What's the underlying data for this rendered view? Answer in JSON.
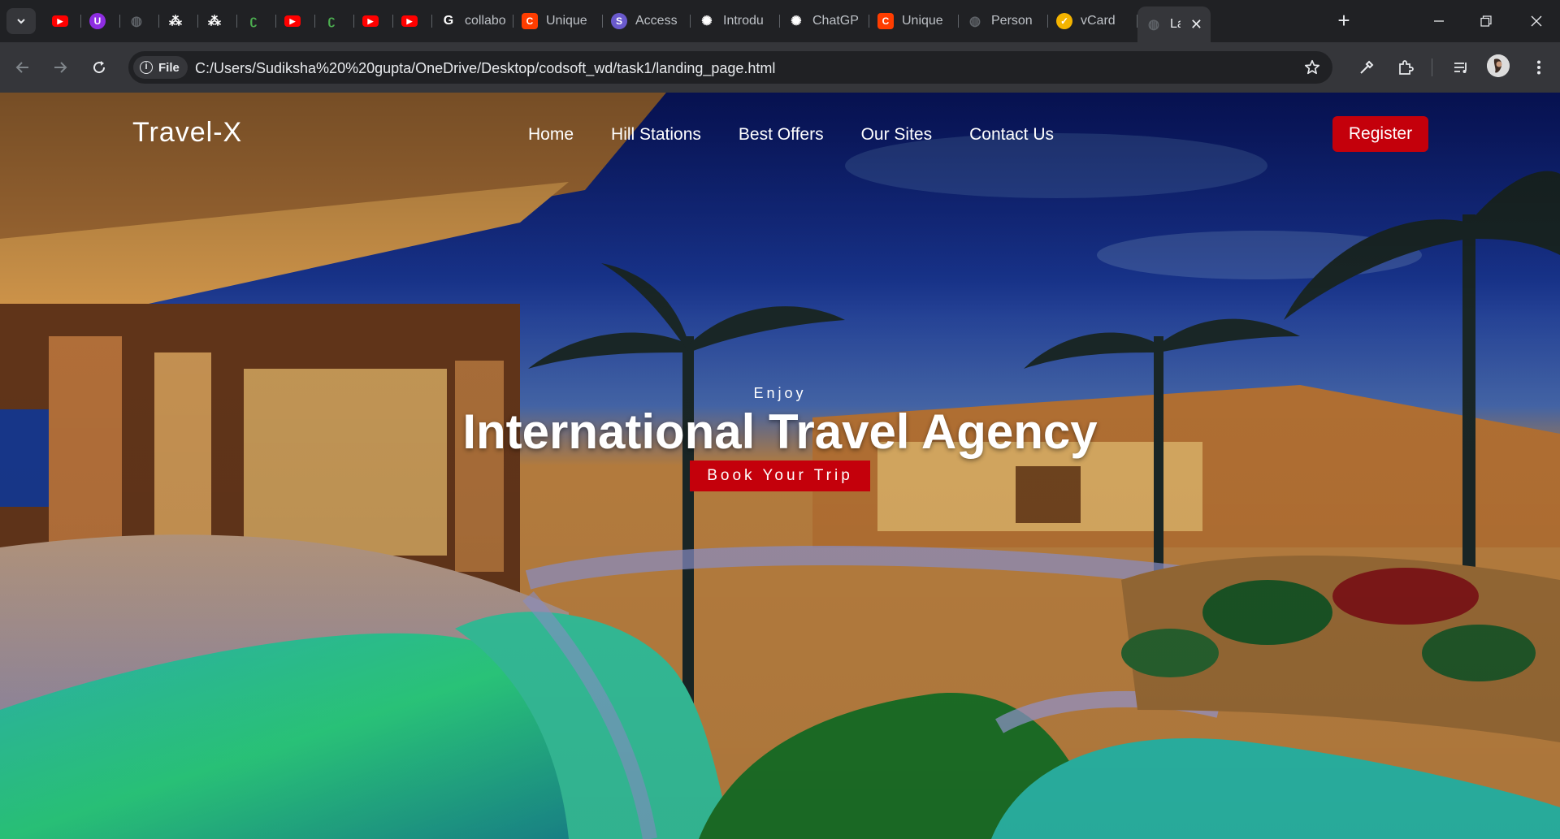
{
  "browser": {
    "tabs": [
      {
        "icon": "youtube-icon",
        "label": "",
        "color": "#ff0000"
      },
      {
        "icon": "u-icon",
        "label": "",
        "color": "#8e2de2"
      },
      {
        "icon": "globe-icon",
        "label": "",
        "color": "#5f6368"
      },
      {
        "icon": "dice-icon",
        "label": "",
        "color": "#ffffff"
      },
      {
        "icon": "dice-icon",
        "label": "",
        "color": "#ffffff"
      },
      {
        "icon": "leetcode-icon",
        "label": "",
        "color": "#4caf50"
      },
      {
        "icon": "youtube-icon",
        "label": "",
        "color": "#ff0000"
      },
      {
        "icon": "leetcode-icon",
        "label": "",
        "color": "#4caf50"
      },
      {
        "icon": "youtube-icon",
        "label": "",
        "color": "#ff0000"
      },
      {
        "icon": "youtube-icon",
        "label": "",
        "color": "#ff0000"
      },
      {
        "icon": "google-icon",
        "label": "collabo",
        "color": "#ffffff"
      },
      {
        "icon": "c-icon",
        "label": "Unique",
        "color": "#ff3d00"
      },
      {
        "icon": "s-icon",
        "label": "Access",
        "color": "#6a5acd"
      },
      {
        "icon": "openai-icon",
        "label": "Introdu",
        "color": "#ffffff"
      },
      {
        "icon": "openai-icon",
        "label": "ChatGP",
        "color": "#ffffff"
      },
      {
        "icon": "c-icon",
        "label": "Unique",
        "color": "#ff3d00"
      },
      {
        "icon": "globe-icon",
        "label": "Person",
        "color": "#5f6368"
      },
      {
        "icon": "vcard-icon",
        "label": "vCard",
        "color": "#f4b400"
      },
      {
        "icon": "globe-icon",
        "label": "La",
        "color": "#5f6368",
        "active": true
      }
    ],
    "new_tab_label": "+",
    "close_tab_glyph": "✕",
    "origin_chip": "File",
    "address": "C:/Users/Sudiksha%20%20gupta/OneDrive/Desktop/codsoft_wd/task1/landing_page.html"
  },
  "site": {
    "logo": "Travel-X",
    "nav": [
      "Home",
      "Hill Stations",
      "Best Offers",
      "Our Sites",
      "Contact Us"
    ],
    "register_label": "Register",
    "hero": {
      "eyebrow": "Enjoy",
      "title": "International Travel Agency",
      "cta_label": "Book Your Trip"
    },
    "colors": {
      "accent": "#c4000b",
      "text": "#ffffff"
    }
  }
}
